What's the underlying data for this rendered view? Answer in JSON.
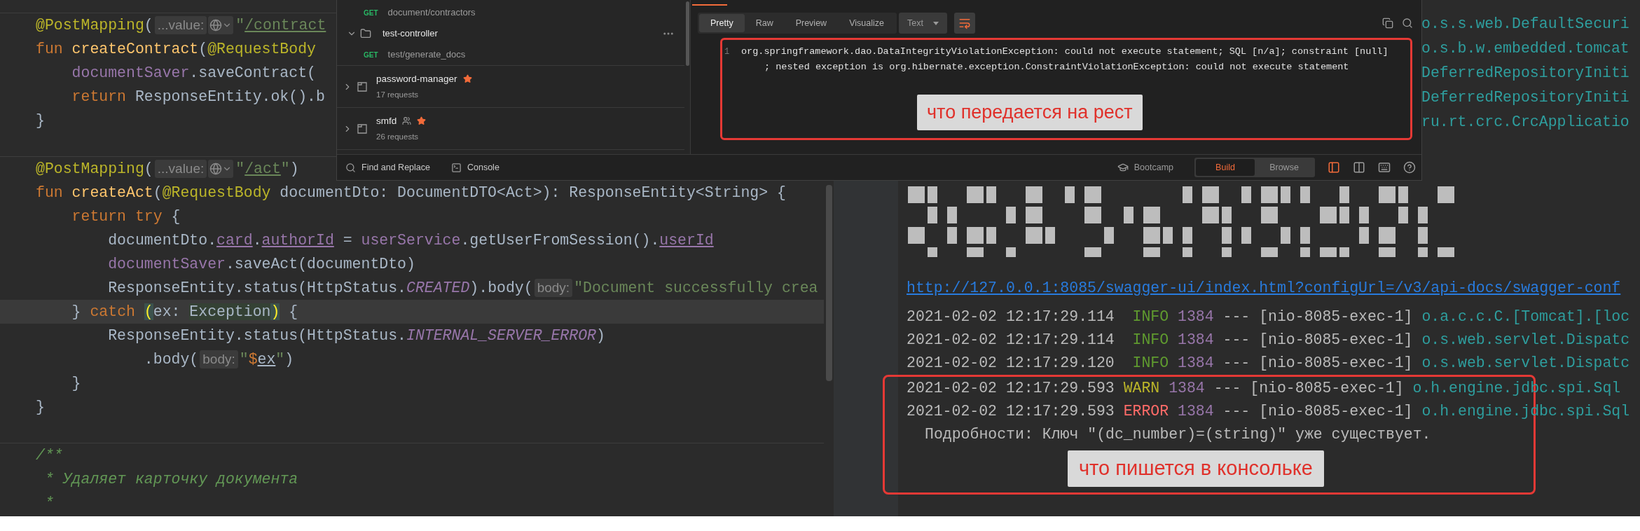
{
  "editor": {
    "blocks": [
      {
        "lines": [
          {
            "current": false,
            "tokens": [
              {
                "kind": "annotation",
                "text": "@PostMapping"
              },
              {
                "kind": "plain",
                "text": "("
              },
              {
                "kind": "hint",
                "text": "...value:"
              },
              {
                "kind": "globe"
              },
              {
                "kind": "string",
                "text": "\""
              },
              {
                "kind": "string_ref",
                "text": "/contract"
              }
            ]
          },
          {
            "current": false,
            "tokens": [
              {
                "kind": "keyword",
                "text": "fun "
              },
              {
                "kind": "function",
                "text": "createContract"
              },
              {
                "kind": "plain",
                "text": "("
              },
              {
                "kind": "annotation",
                "text": "@RequestBody"
              }
            ]
          },
          {
            "current": false,
            "tokens": [
              {
                "kind": "property",
                "text": "    documentSaver"
              },
              {
                "kind": "plain",
                "text": ".saveContract("
              }
            ]
          },
          {
            "current": false,
            "tokens": [
              {
                "kind": "keyword",
                "text": "    return "
              },
              {
                "kind": "plain",
                "text": "ResponseEntity.ok().b"
              }
            ]
          },
          {
            "current": false,
            "tokens": [
              {
                "kind": "plain",
                "text": "}"
              }
            ]
          }
        ]
      },
      {
        "lines": [
          {
            "current": false,
            "tokens": [
              {
                "kind": "annotation",
                "text": "@PostMapping"
              },
              {
                "kind": "plain",
                "text": "("
              },
              {
                "kind": "hint",
                "text": "...value:"
              },
              {
                "kind": "globe"
              },
              {
                "kind": "string",
                "text": "\""
              },
              {
                "kind": "string_ref",
                "text": "/act"
              },
              {
                "kind": "string",
                "text": "\""
              },
              {
                "kind": "plain",
                "text": ")"
              }
            ]
          },
          {
            "current": false,
            "tokens": [
              {
                "kind": "keyword",
                "text": "fun "
              },
              {
                "kind": "function",
                "text": "createAct"
              },
              {
                "kind": "plain",
                "text": "("
              },
              {
                "kind": "annotation",
                "text": "@RequestBody"
              },
              {
                "kind": "plain",
                "text": " documentDto: DocumentDTO<Act>): ResponseEntity<String> {"
              }
            ]
          },
          {
            "current": false,
            "tokens": [
              {
                "kind": "keyword",
                "text": "    return try"
              },
              {
                "kind": "plain",
                "text": " {"
              }
            ]
          },
          {
            "current": false,
            "tokens": [
              {
                "kind": "plain",
                "text": "        documentDto."
              },
              {
                "kind": "property_ref",
                "text": "card"
              },
              {
                "kind": "plain",
                "text": "."
              },
              {
                "kind": "property_ref",
                "text": "authorId"
              },
              {
                "kind": "plain",
                "text": " = "
              },
              {
                "kind": "property",
                "text": "userService"
              },
              {
                "kind": "plain",
                "text": ".getUserFromSession()."
              },
              {
                "kind": "property_ref",
                "text": "userId"
              }
            ]
          },
          {
            "current": false,
            "tokens": [
              {
                "kind": "property",
                "text": "        documentSaver"
              },
              {
                "kind": "plain",
                "text": ".saveAct(documentDto)"
              }
            ]
          },
          {
            "current": false,
            "tokens": [
              {
                "kind": "plain",
                "text": "        ResponseEntity.status(HttpStatus."
              },
              {
                "kind": "constant",
                "text": "CREATED"
              },
              {
                "kind": "plain",
                "text": ").body("
              },
              {
                "kind": "hint",
                "text": "body:"
              },
              {
                "kind": "string",
                "text": "\"Document successfully crea"
              }
            ]
          },
          {
            "current": true,
            "tokens": [
              {
                "kind": "plain",
                "text": "    } "
              },
              {
                "kind": "keyword",
                "text": "catch "
              },
              {
                "kind": "brace_match",
                "text": "("
              },
              {
                "kind": "plain",
                "text": "ex: "
              },
              {
                "kind": "type_hl",
                "text": "Exception"
              },
              {
                "kind": "brace_match",
                "text": ")"
              },
              {
                "kind": "plain",
                "text": " {"
              }
            ]
          },
          {
            "current": false,
            "tokens": [
              {
                "kind": "plain",
                "text": "        ResponseEntity.status(HttpStatus."
              },
              {
                "kind": "constant",
                "text": "INTERNAL_SERVER_ERROR"
              },
              {
                "kind": "plain",
                "text": ")"
              }
            ]
          },
          {
            "current": false,
            "tokens": [
              {
                "kind": "plain",
                "text": "            .body("
              },
              {
                "kind": "hint",
                "text": "body:"
              },
              {
                "kind": "string",
                "text": "\""
              },
              {
                "kind": "template",
                "text": "$"
              },
              {
                "kind": "var_ref",
                "text": "ex"
              },
              {
                "kind": "string",
                "text": "\""
              },
              {
                "kind": "plain",
                "text": ")"
              }
            ]
          },
          {
            "current": false,
            "tokens": [
              {
                "kind": "plain",
                "text": "    }"
              }
            ]
          },
          {
            "current": false,
            "tokens": [
              {
                "kind": "plain",
                "text": "}"
              }
            ]
          }
        ]
      },
      {
        "lines": [
          {
            "current": false,
            "tokens": [
              {
                "kind": "comment",
                "text": "/**"
              }
            ]
          },
          {
            "current": false,
            "tokens": [
              {
                "kind": "comment",
                "text": " * Удаляет карточку документа"
              }
            ]
          },
          {
            "current": false,
            "tokens": [
              {
                "kind": "comment",
                "text": " *"
              }
            ]
          }
        ]
      }
    ]
  },
  "postman": {
    "sidebar": {
      "items": [
        {
          "kind": "request",
          "method": "GET",
          "name": "document/contractors"
        },
        {
          "kind": "folder",
          "name": "test-controller",
          "expanded": true
        },
        {
          "kind": "request",
          "method": "GET",
          "name": "test/generate_docs"
        },
        {
          "kind": "collection",
          "name": "password-manager",
          "count": "17 requests",
          "expanded": false,
          "shared": false,
          "favorite": true
        },
        {
          "kind": "collection",
          "name": "smfd",
          "count": "26 requests",
          "expanded": false,
          "shared": true,
          "favorite": true
        }
      ]
    },
    "response": {
      "view_tabs": [
        {
          "label": "Pretty",
          "selected": true
        },
        {
          "label": "Raw",
          "selected": false
        },
        {
          "label": "Preview",
          "selected": false
        },
        {
          "label": "Visualize",
          "selected": false
        }
      ],
      "format": "Text",
      "wrap_on": true,
      "line_number": "1",
      "lines": [
        "org.springframework.dao.DataIntegrityViolationException: could not execute statement; SQL [n/a]; constraint [null]",
        "; nested exception is org.hibernate.exception.ConstraintViolationException: could not execute statement"
      ],
      "annotation": "что передается на рест"
    },
    "footer": {
      "left": [
        {
          "kind": "search",
          "label": "Find and Replace"
        },
        {
          "kind": "console",
          "label": "Console"
        }
      ],
      "bootcamp": "Bootcamp",
      "modes": [
        {
          "label": "Build",
          "selected": true
        },
        {
          "label": "Browse",
          "selected": false
        }
      ],
      "icons": [
        {
          "kind": "two_pane",
          "active": true
        },
        {
          "kind": "split",
          "active": false
        },
        {
          "kind": "keyboard",
          "active": false
        },
        {
          "kind": "help",
          "active": false
        }
      ]
    }
  },
  "console": {
    "tails": [
      "o.s.s.web.DefaultSecuri",
      "o.s.b.w.embedded.tomcat",
      "DeferredRepositoryIniti",
      "DeferredRepositoryIniti",
      "ru.rt.crc.CrcApplicatio"
    ],
    "link": "http://127.0.0.1:8085/swagger-ui/index.html?configUrl=/v3/api-docs/swagger-conf",
    "rows": [
      {
        "timestamp": "2021-02-02 12:17:29.114",
        "kind": "info",
        "severity": "INFO",
        "pid": "1384",
        "thread": "--- [nio-8085-exec-1]",
        "logger": "o.a.c.c.C.[Tomcat].[loc"
      },
      {
        "timestamp": "2021-02-02 12:17:29.114",
        "kind": "info",
        "severity": "INFO",
        "pid": "1384",
        "thread": "--- [nio-8085-exec-1]",
        "logger": "o.s.web.servlet.Dispatc"
      },
      {
        "timestamp": "2021-02-02 12:17:29.120",
        "kind": "info",
        "severity": "INFO",
        "pid": "1384",
        "thread": "--- [nio-8085-exec-1]",
        "logger": "o.s.web.servlet.Dispatc"
      }
    ],
    "marked_rows": [
      {
        "timestamp": "2021-02-02 12:17:29.593",
        "kind": "warn",
        "severity": "WARN",
        "pid": "1384",
        "thread": "--- [nio-8085-exec-1]",
        "logger": "o.h.engine.jdbc.spi.Sql"
      },
      {
        "timestamp": "2021-02-02 12:17:29.593",
        "kind": "error",
        "severity": "ERROR",
        "pid": "1384",
        "thread": "--- [nio-8085-exec-1]",
        "logger": "o.h.engine.jdbc.spi.Sql"
      }
    ],
    "detail": "Подробности: Ключ \"(dc_number)=(string)\" уже существует.",
    "annotation": "что пишется в консольке"
  }
}
